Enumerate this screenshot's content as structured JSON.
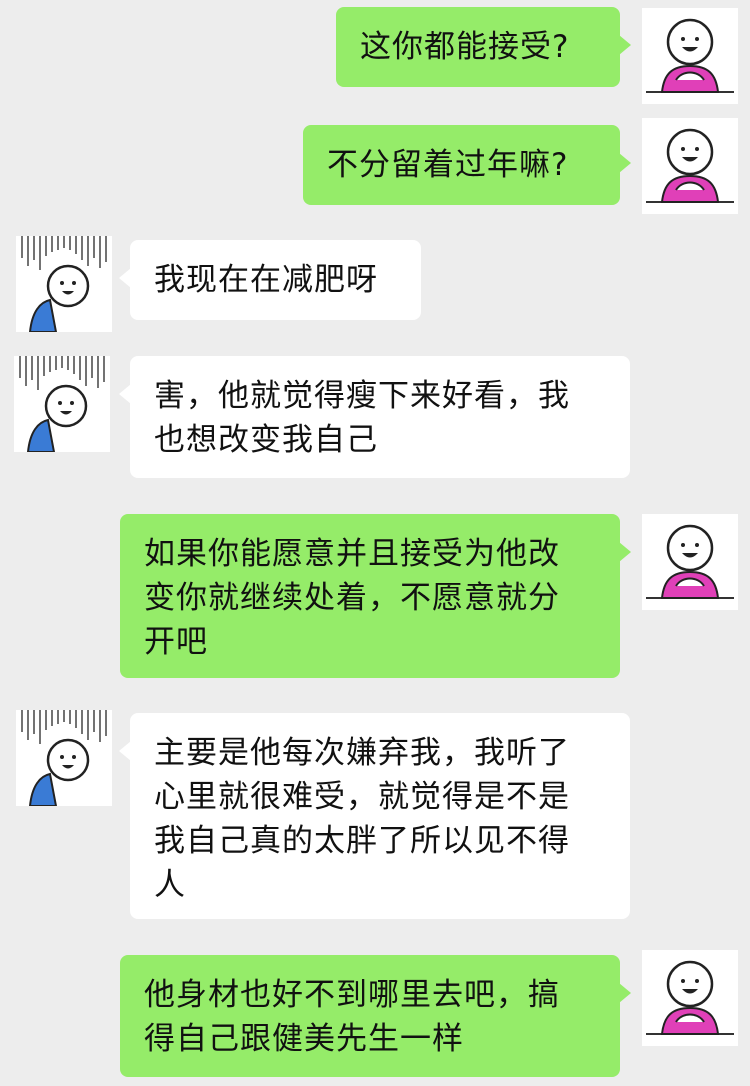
{
  "chat": {
    "messages": [
      {
        "sender": "me",
        "text": "这你都能接受?"
      },
      {
        "sender": "me",
        "text": "不分留着过年嘛?"
      },
      {
        "sender": "other",
        "text": "我现在在减肥呀"
      },
      {
        "sender": "other",
        "text": "害，他就觉得瘦下来好看，我\n也想改变我自己"
      },
      {
        "sender": "me",
        "text": "如果你能愿意并且接受为他改\n变你就继续处着，不愿意就分\n开吧"
      },
      {
        "sender": "other",
        "text": "主要是他每次嫌弃我，我听了\n心里就很难受，就觉得是不是\n我自己真的太胖了所以见不得\n人"
      },
      {
        "sender": "me",
        "text": "他身材也好不到哪里去吧，搞\n得自己跟健美先生一样"
      }
    ]
  },
  "colors": {
    "background": "#ededed",
    "my_bubble": "#95ec69",
    "their_bubble": "#ffffff",
    "text": "#111111",
    "my_avatar_shirt": "#e040b8",
    "their_avatar_shirt": "#3a7bd5"
  },
  "icons": {
    "my_avatar": "smiling-stick-figure-pink",
    "their_avatar": "gloomy-stick-figure-blue"
  }
}
